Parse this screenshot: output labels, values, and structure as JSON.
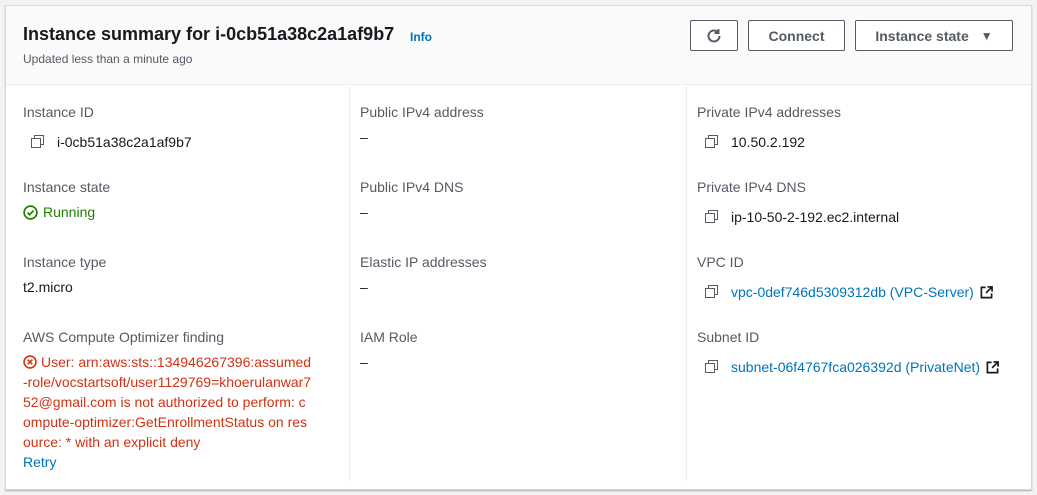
{
  "header": {
    "title": "Instance summary for i-0cb51a38c2a1af9b7",
    "info_label": "Info",
    "subtitle": "Updated less than a minute ago",
    "connect_label": "Connect",
    "instance_state_label": "Instance state",
    "refresh_icon": "refresh-icon",
    "caret_icon": "caret-down-icon"
  },
  "col1": {
    "instance_id_label": "Instance ID",
    "instance_id_value": "i-0cb51a38c2a1af9b7",
    "instance_state_label": "Instance state",
    "instance_state_value": "Running",
    "instance_type_label": "Instance type",
    "instance_type_value": "t2.micro",
    "optimizer_label": "AWS Compute Optimizer finding",
    "optimizer_error": "User: arn:aws:sts::134946267396:assumed-role/vocstartsoft/user1129769=khoerulanwar752@gmail.com is not authorized to perform: compute-optimizer:GetEnrollmentStatus on resource: * with an explicit deny",
    "retry_label": "Retry"
  },
  "col2": {
    "public_ipv4_label": "Public IPv4 address",
    "public_ipv4_value": "–",
    "public_dns_label": "Public IPv4 DNS",
    "public_dns_value": "–",
    "elastic_ip_label": "Elastic IP addresses",
    "elastic_ip_value": "–",
    "iam_role_label": "IAM Role",
    "iam_role_value": "–"
  },
  "col3": {
    "private_ipv4_label": "Private IPv4 addresses",
    "private_ipv4_value": "10.50.2.192",
    "private_dns_label": "Private IPv4 DNS",
    "private_dns_value": "ip-10-50-2-192.ec2.internal",
    "vpc_label": "VPC ID",
    "vpc_value": "vpc-0def746d5309312db (VPC-Server)",
    "subnet_label": "Subnet ID",
    "subnet_value": "subnet-06f4767fca026392d (PrivateNet)"
  },
  "colors": {
    "link": "#0073bb",
    "success": "#1d8102",
    "error": "#d13212",
    "label": "#545b64"
  }
}
